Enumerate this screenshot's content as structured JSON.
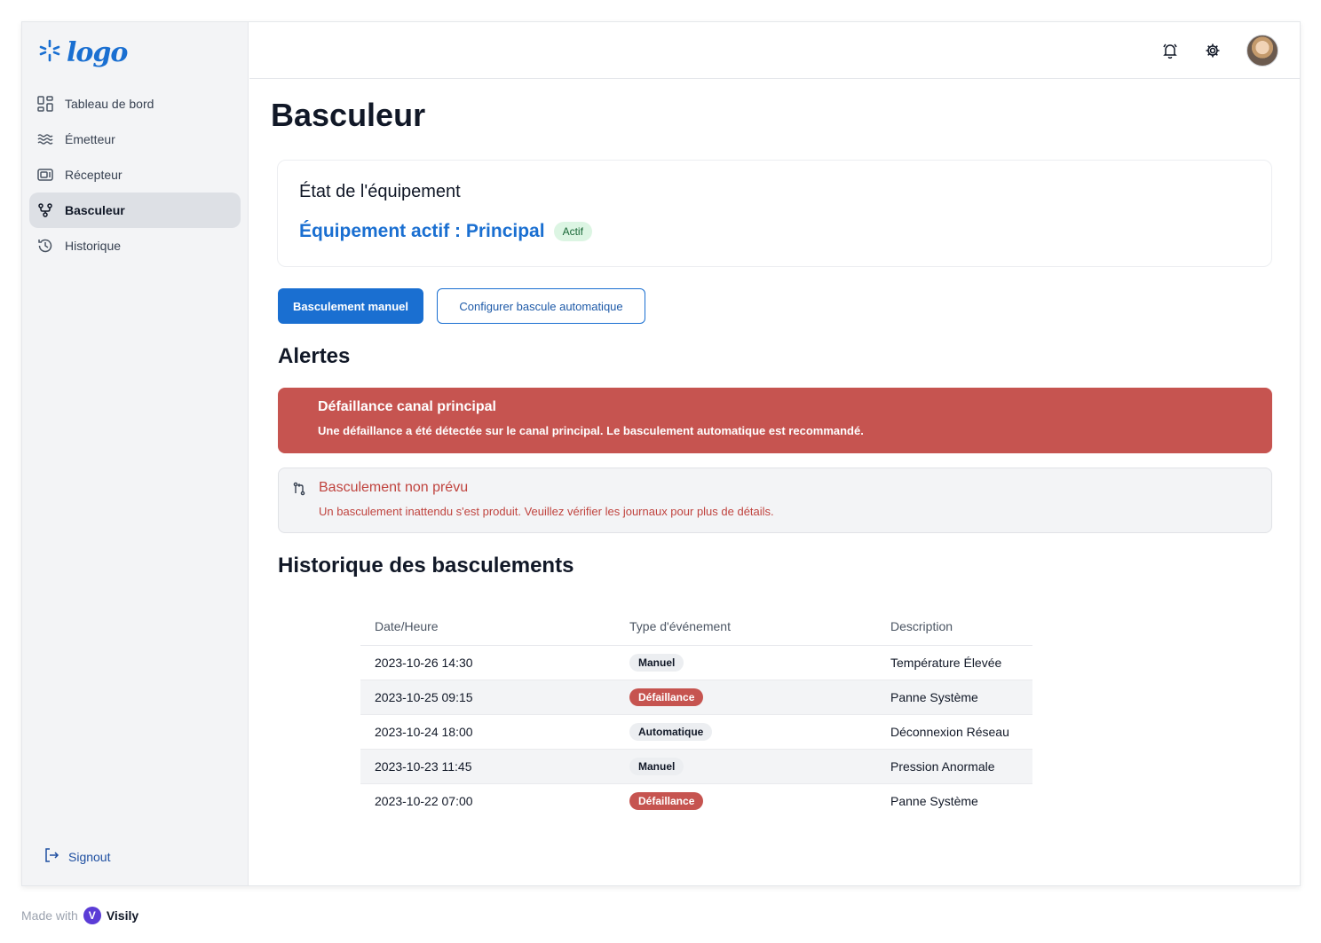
{
  "brand": {
    "logo_text": "logo",
    "accent": "#1a6fd1"
  },
  "sidebar": {
    "items": [
      {
        "label": "Tableau de bord",
        "icon": "dashboard-grid-icon",
        "active": false
      },
      {
        "label": "Émetteur",
        "icon": "waves-icon",
        "active": false
      },
      {
        "label": "Récepteur",
        "icon": "receiver-icon",
        "active": false
      },
      {
        "label": "Basculeur",
        "icon": "git-branch-icon",
        "active": true
      },
      {
        "label": "Historique",
        "icon": "history-icon",
        "active": false
      }
    ],
    "signout_label": "Signout"
  },
  "topbar": {
    "icons": [
      "bell-icon",
      "gear-icon",
      "avatar"
    ]
  },
  "page": {
    "title": "Basculeur"
  },
  "status_card": {
    "title": "État de l'équipement",
    "active_text": "Équipement actif : Principal",
    "badge": "Actif"
  },
  "actions": {
    "manual_label": "Basculement manuel",
    "auto_label": "Configurer bascule automatique"
  },
  "alerts": {
    "heading": "Alertes",
    "items": [
      {
        "title": "Défaillance canal principal",
        "message": "Une défaillance a été détectée sur le canal principal. Le basculement automatique est recommandé.",
        "severity": "danger",
        "color": "#c65450"
      },
      {
        "title": "Basculement non prévu",
        "message": "Un basculement inattendu s'est produit. Veuillez vérifier les journaux pour plus de détails.",
        "severity": "warning",
        "icon": "git-compare-icon"
      }
    ]
  },
  "history": {
    "heading": "Historique des basculements",
    "columns": [
      "Date/Heure",
      "Type d'événement",
      "Description"
    ],
    "rows": [
      {
        "date": "2023-10-26 14:30",
        "type": "Manuel",
        "type_style": "neutral",
        "description": "Température Élevée"
      },
      {
        "date": "2023-10-25 09:15",
        "type": "Défaillance",
        "type_style": "danger",
        "description": "Panne Système"
      },
      {
        "date": "2023-10-24 18:00",
        "type": "Automatique",
        "type_style": "neutral",
        "description": "Déconnexion Réseau"
      },
      {
        "date": "2023-10-23 11:45",
        "type": "Manuel",
        "type_style": "neutral",
        "description": "Pression Anormale"
      },
      {
        "date": "2023-10-22 07:00",
        "type": "Défaillance",
        "type_style": "danger",
        "description": "Panne Système"
      }
    ]
  },
  "footer": {
    "made_with": "Made with",
    "brand": "Visily"
  }
}
